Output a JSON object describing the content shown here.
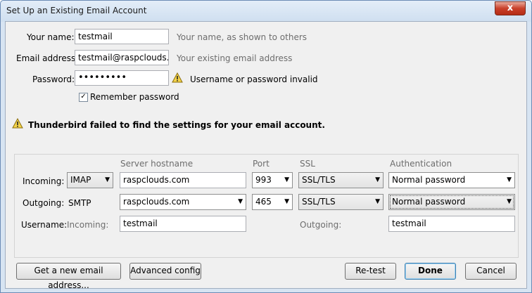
{
  "window": {
    "title": "Set Up an Existing Email Account",
    "close": "x"
  },
  "identity": {
    "name_label": "Your name:",
    "name_value": "testmail",
    "name_hint": "Your name, as shown to others",
    "email_label": "Email address:",
    "email_value": "testmail@raspclouds.co",
    "email_hint": "Your existing email address",
    "password_label": "Password:",
    "password_value": "•••••••••",
    "password_error": "Username or password invalid",
    "remember_label": "Remember password",
    "remember_checked": "✓"
  },
  "banner": {
    "text": "Thunderbird failed to find the settings for your email account."
  },
  "server": {
    "headers": {
      "hostname": "Server hostname",
      "port": "Port",
      "ssl": "SSL",
      "auth": "Authentication"
    },
    "incoming": {
      "label": "Incoming:",
      "protocol": "IMAP",
      "hostname": "raspclouds.com",
      "port": "993",
      "ssl": "SSL/TLS",
      "auth": "Normal password"
    },
    "outgoing": {
      "label": "Outgoing:",
      "protocol": "SMTP",
      "hostname": "raspclouds.com",
      "port": "465",
      "ssl": "SSL/TLS",
      "auth": "Normal password"
    },
    "username": {
      "label": "Username:",
      "incoming_label": "Incoming:",
      "incoming_value": "testmail",
      "outgoing_label": "Outgoing:",
      "outgoing_value": "testmail"
    }
  },
  "buttons": {
    "new_address": "Get a new email address...",
    "advanced": "Advanced config",
    "retest": "Re-test",
    "done": "Done",
    "cancel": "Cancel"
  },
  "icons": {
    "warning": "warning-triangle-icon",
    "dropdown": "chevron-down-icon"
  }
}
